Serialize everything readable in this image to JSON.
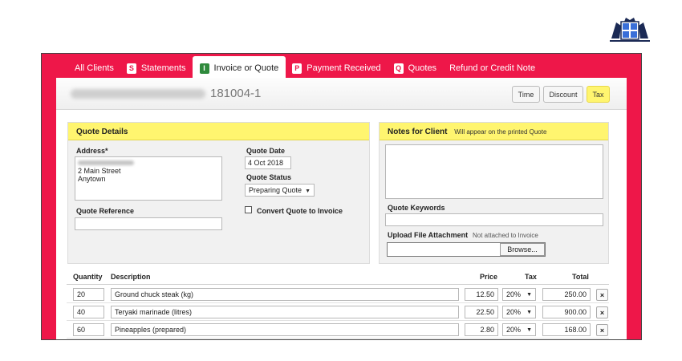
{
  "tabs": [
    {
      "label": "All Clients",
      "icon": "none"
    },
    {
      "label": "Statements",
      "icon": "statement-s-icon"
    },
    {
      "label": "Invoice or Quote",
      "icon": "invoice-i-icon"
    },
    {
      "label": "Payment Received",
      "icon": "payment-p-icon"
    },
    {
      "label": "Quotes",
      "icon": "quotes-q-icon"
    },
    {
      "label": "Refund or Credit Note",
      "icon": "none"
    }
  ],
  "header": {
    "quote_number": "181004-1",
    "buttons": {
      "time": "Time",
      "discount": "Discount",
      "tax": "Tax"
    }
  },
  "quote_details": {
    "title": "Quote Details",
    "address_label": "Address*",
    "address_lines": [
      "2 Main Street",
      "Anytown"
    ],
    "reference_label": "Quote Reference",
    "reference_value": "",
    "date_label": "Quote Date",
    "date_value": "4 Oct 2018",
    "status_label": "Quote Status",
    "status_value": "Preparing Quote",
    "convert_label": "Convert Quote to Invoice",
    "convert_checked": false
  },
  "notes": {
    "title": "Notes for Client",
    "subtitle": "Will appear on the printed Quote",
    "keywords_label": "Quote Keywords",
    "upload_label": "Upload File Attachment",
    "upload_note": "Not attached to Invoice",
    "browse_label": "Browse..."
  },
  "table": {
    "headers": {
      "quantity": "Quantity",
      "description": "Description",
      "price": "Price",
      "tax": "Tax",
      "total": "Total"
    },
    "delete_label": "×",
    "rows": [
      {
        "quantity": "20",
        "description": "Ground chuck steak (kg)",
        "price": "12.50",
        "tax": "20%",
        "total": "250.00"
      },
      {
        "quantity": "40",
        "description": "Teryaki marinade (litres)",
        "price": "22.50",
        "tax": "20%",
        "total": "900.00"
      },
      {
        "quantity": "60",
        "description": "Pineapples (prepared)",
        "price": "2.80",
        "tax": "20%",
        "total": "168.00"
      }
    ]
  },
  "colors": {
    "brand": "#ee1749",
    "highlight": "#fff56f",
    "active_tab_icon": "#2f8a3c"
  }
}
